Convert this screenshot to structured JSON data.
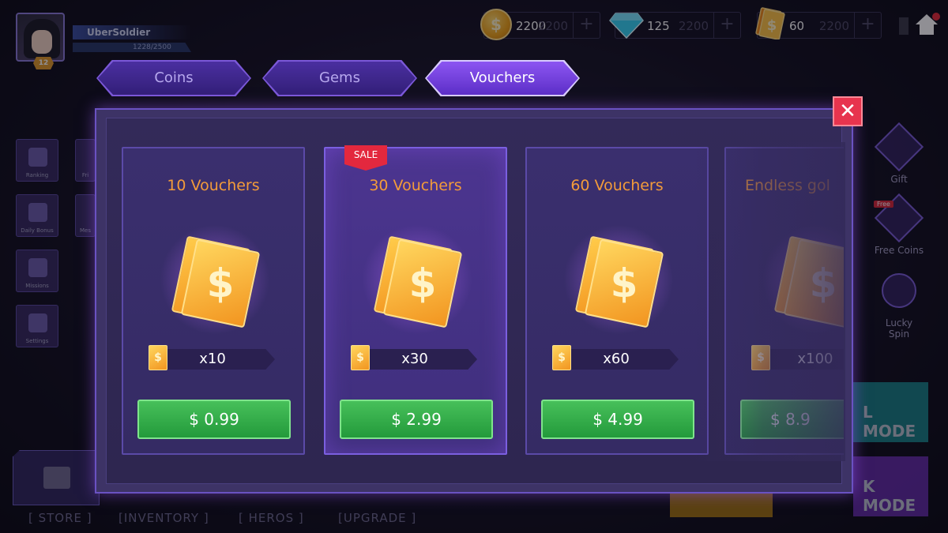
{
  "profile": {
    "name": "UberSoldier",
    "xp": "1228/2500",
    "level": "12"
  },
  "currencies": [
    {
      "name": "coins",
      "value": "2200",
      "ghost": "2200"
    },
    {
      "name": "gems",
      "value": "125",
      "ghost": "2200"
    },
    {
      "name": "vouchers",
      "value": "60",
      "ghost": "2200"
    }
  ],
  "icons": {
    "coin_glyph": "$",
    "voucher_glyph": "$",
    "close_glyph": "✕",
    "plus_glyph": "+"
  },
  "tabs": [
    {
      "label": "Coins",
      "active": false
    },
    {
      "label": "Gems",
      "active": false
    },
    {
      "label": "Vouchers",
      "active": true
    }
  ],
  "left_menu": [
    "Ranking",
    "Fri",
    "Daily Bonus",
    "Mes",
    "Missions",
    "Settings"
  ],
  "right_menu": [
    {
      "label": "Gift"
    },
    {
      "label": "Free Coins",
      "badge": "Free"
    },
    {
      "label": "Lucky Spin"
    }
  ],
  "modes": [
    "L MODE",
    "K MODE"
  ],
  "bottom_nav": [
    "[ STORE ]",
    "[INVENTORY ]",
    "[ HEROS ]",
    "[UPGRADE ]"
  ],
  "sale_badge": "SALE",
  "cards": [
    {
      "title": "10 Vouchers",
      "quantity": "x10",
      "price": "$ 0.99",
      "sale": false
    },
    {
      "title": "30 Vouchers",
      "quantity": "x30",
      "price": "$ 2.99",
      "sale": true
    },
    {
      "title": "60 Vouchers",
      "quantity": "x60",
      "price": "$ 4.99",
      "sale": false
    },
    {
      "title": "Endless gol",
      "quantity": "x100",
      "price": "$ 8.9",
      "sale": false
    }
  ],
  "colors": {
    "accent_purple": "#7b58d8",
    "title_orange": "#f39b3a",
    "buy_green": "#2fae48",
    "close_red": "#e7344e"
  }
}
